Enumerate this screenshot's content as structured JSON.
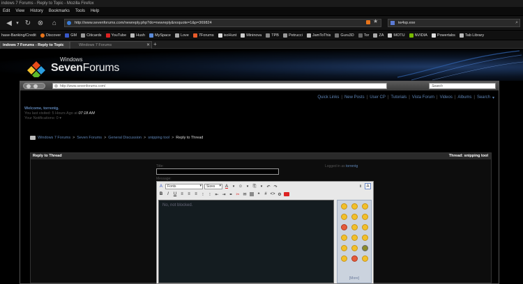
{
  "window": {
    "title": "indows 7 Forums - Reply to Topic - Mozilla Firefox"
  },
  "menu": [
    "Edit",
    "View",
    "History",
    "Bookmarks",
    "Tools",
    "Help"
  ],
  "navbar": {
    "url": "http://www.sevenforums.com/newreply.php?do=newreply&noquote=1&p=369824",
    "search_value": "iw4sp.exe"
  },
  "bookmarks": [
    "hase-Banking/Credit",
    "Discover",
    "GM",
    "Citicards",
    "YouTube",
    "Hush",
    "MySpace",
    "Love",
    "7Forums",
    "isoHunt",
    "Mininova",
    "TPB",
    "Petrucci",
    "JamToThis",
    "Guru3D",
    "Tor",
    "ZA",
    "MOTU",
    "NVIDIA",
    "Powertabs",
    "Tab Library"
  ],
  "tabs": {
    "active": "indows 7 Forums - Reply to Topic",
    "inactive": "Windows 7 Forums"
  },
  "site": {
    "logo_top": "Windows",
    "logo_name_bold": "Seven",
    "logo_name_light": "Forums",
    "frame_url": "http://www.sevenforums.com/",
    "frame_search": "Search",
    "quicklinks": [
      "Quick Links",
      "New Posts",
      "User CP",
      "Tutorials",
      "Vista Forum",
      "Videos",
      "Albums",
      "Search"
    ],
    "welcome": "Welcome, torrentg.",
    "last_visited": "You last visited: 5 Hours Ago at",
    "last_visited_time": "07:18 AM",
    "notifications": "Your Notifications: 0",
    "breadcrumb": [
      "Windows 7 Forums",
      "Seven Forums",
      "General Discussion",
      "snipping tool"
    ],
    "breadcrumb_current": "Reply to Thread"
  },
  "reply": {
    "header": "Reply to Thread",
    "thread_label": "Thread: snipping tool",
    "title_label": "Title:",
    "logged_in_prefix": "Logged in as",
    "logged_in_user": "torrentg",
    "message_label": "Message:",
    "font_select": "Fonts",
    "size_select": "Sizes",
    "message_text": "No, not blocked.",
    "smilies_more": "[More]"
  }
}
